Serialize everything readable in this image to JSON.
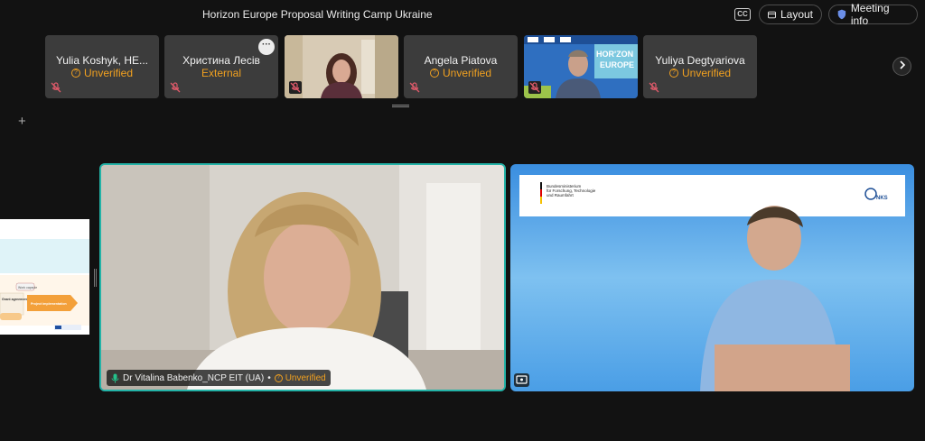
{
  "header": {
    "meeting_title": "Horizon Europe Proposal Writing Camp Ukraine",
    "cc_label": "CC",
    "layout_label": "Layout",
    "meeting_info_label": "Meeting info"
  },
  "participants": [
    {
      "name": "Yulia Koshyk, HE...",
      "status": "Unverified"
    },
    {
      "name": "Христина Лесів",
      "status": "External"
    },
    {
      "name": "",
      "status": ""
    },
    {
      "name": "Angela Piatova",
      "status": "Unverified"
    },
    {
      "name": "",
      "status": ""
    },
    {
      "name": "Yuliya Degtyariova",
      "status": "Unverified"
    }
  ],
  "more_label": "···",
  "main": {
    "speaker_name": "Dr Vitalina Babenko_NCP EIT (UA)",
    "speaker_separator": "•",
    "speaker_status": "Unverified"
  },
  "slide_right": {
    "ministry_line1": "Bundesministerium",
    "ministry_line2": "für Forschung, Technologie",
    "ministry_line3": "und Raumfahrt",
    "nks_label": "NKS"
  },
  "slide_left": {
    "box1": "Grant agreement preparation",
    "box2": "Project implementation",
    "top_label": "Work capsule"
  },
  "thumbnail_banner": "HORIZON EUROPE",
  "colors": {
    "accent_teal": "#23b3a7",
    "unverified_orange": "#f0a020",
    "tile_bg": "#3c3c3c",
    "app_bg": "#121212"
  }
}
